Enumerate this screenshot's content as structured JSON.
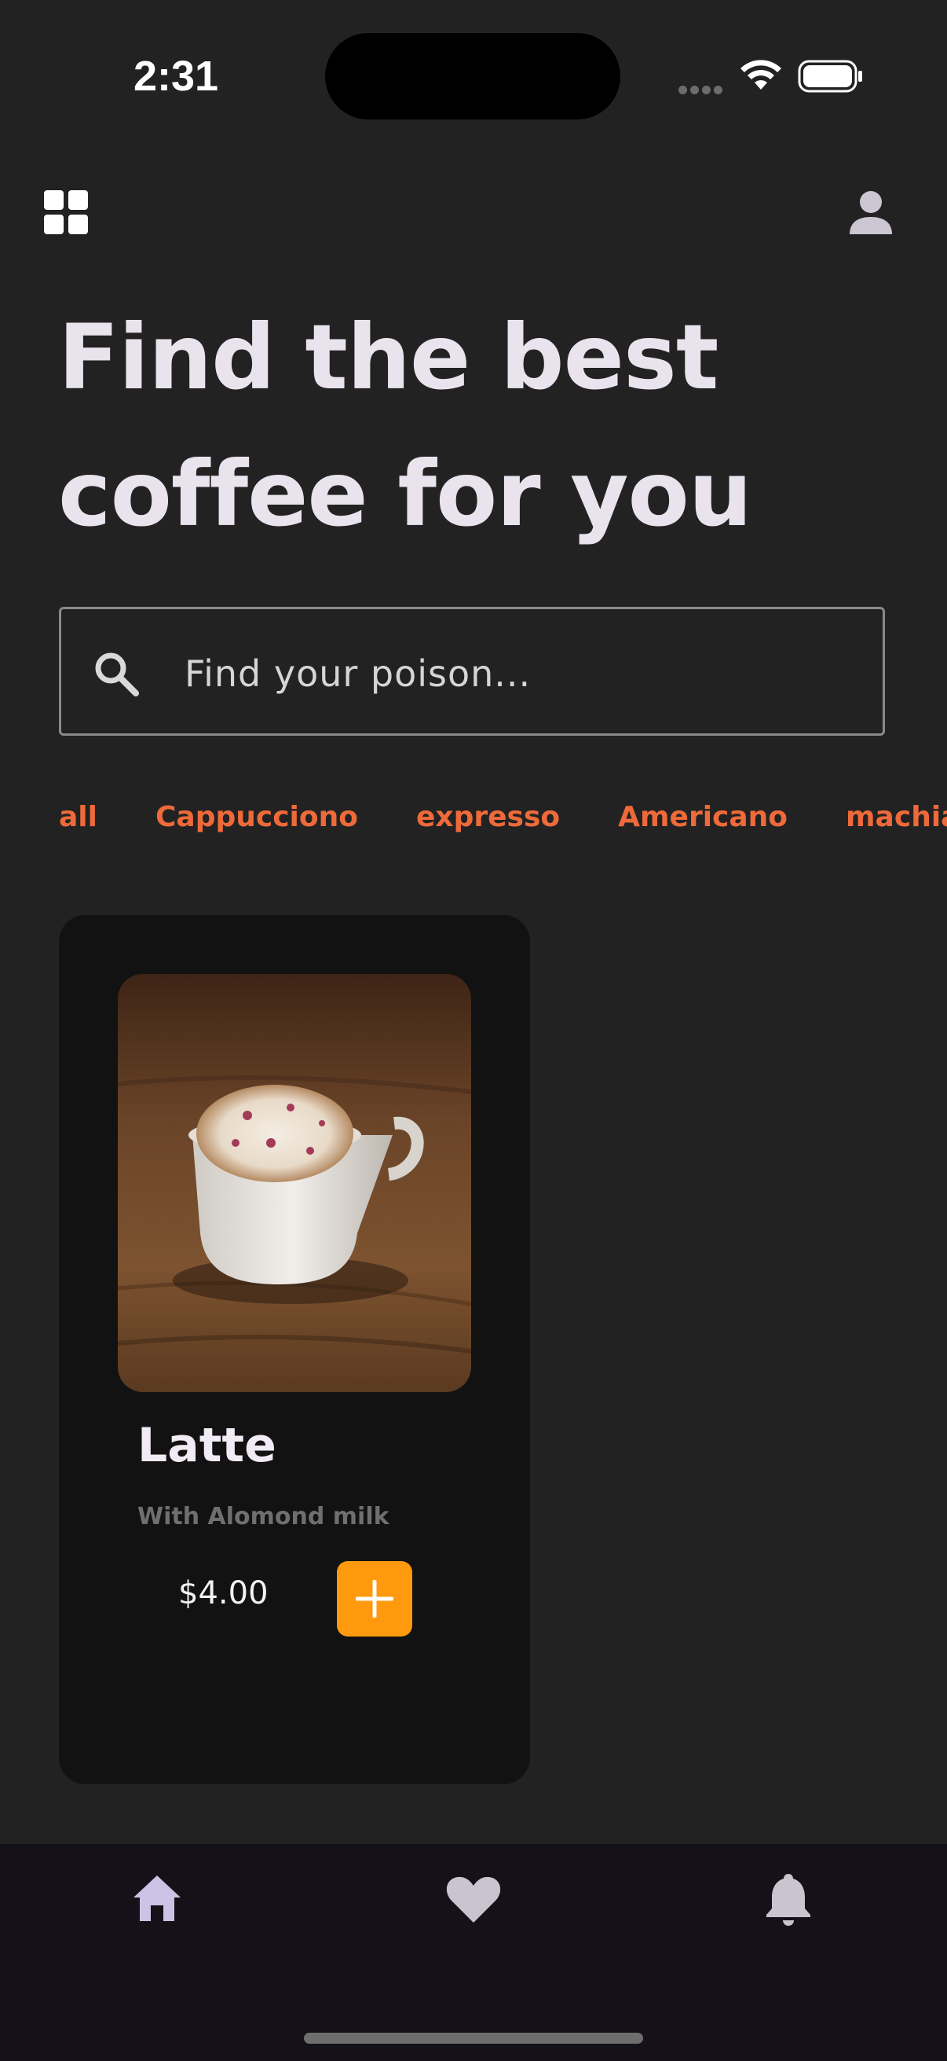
{
  "status_bar": {
    "time": "2:31",
    "icons": [
      "signal-icon",
      "wifi-icon",
      "battery-icon"
    ]
  },
  "header": {
    "left_icon": "grid-menu-icon",
    "right_icon": "person-icon"
  },
  "headline": {
    "line1": "Find the best",
    "line2": "coffee for you"
  },
  "search": {
    "icon": "search-icon",
    "placeholder": "Find your poison...",
    "value": ""
  },
  "categories": [
    "all",
    "Cappucciono",
    "expresso",
    "Americano",
    "machiato"
  ],
  "products": [
    {
      "name": "Latte",
      "description": "With Alomond milk",
      "price": "$4.00",
      "add_icon": "plus-icon"
    }
  ],
  "bottom_nav": [
    {
      "icon": "home-icon",
      "active": true
    },
    {
      "icon": "heart-icon",
      "active": false
    },
    {
      "icon": "bell-icon",
      "active": false
    }
  ],
  "colors": {
    "background": "#222222",
    "card": "#121212",
    "accent_text": "#ee6a3a",
    "add_button": "#ff9a0e",
    "nav_bg": "#141218",
    "active_nav": "#cbc2e6"
  }
}
